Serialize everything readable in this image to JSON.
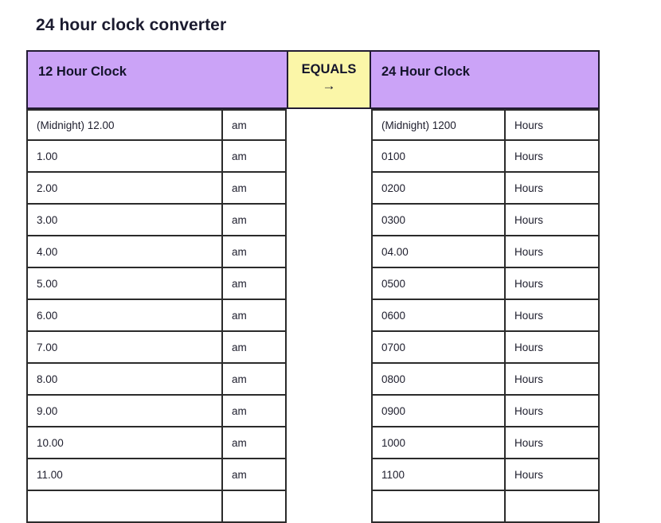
{
  "page": {
    "title": "24 hour clock converter",
    "background": "#ffffff"
  },
  "colors": {
    "header_purple": "#cba3f7",
    "header_yellow": "#fbf6a8",
    "border": "#2b2b2b",
    "text": "#20202f"
  },
  "table": {
    "headers": {
      "left": "12 Hour Clock",
      "middle": "EQUALS",
      "middle_icon": "→",
      "right": "24 Hour Clock"
    },
    "rows": [
      {
        "twelve": "(Midnight) 12.00",
        "meridiem": "am",
        "twentyfour": "(Midnight) 1200",
        "unit": "Hours"
      },
      {
        "twelve": "1.00",
        "meridiem": "am",
        "twentyfour": "0100",
        "unit": "Hours"
      },
      {
        "twelve": "2.00",
        "meridiem": "am",
        "twentyfour": "0200",
        "unit": "Hours"
      },
      {
        "twelve": "3.00",
        "meridiem": "am",
        "twentyfour": "0300",
        "unit": "Hours"
      },
      {
        "twelve": "4.00",
        "meridiem": "am",
        "twentyfour": "04.00",
        "unit": "Hours"
      },
      {
        "twelve": "5.00",
        "meridiem": "am",
        "twentyfour": "0500",
        "unit": "Hours"
      },
      {
        "twelve": "6.00",
        "meridiem": "am",
        "twentyfour": "0600",
        "unit": "Hours"
      },
      {
        "twelve": "7.00",
        "meridiem": "am",
        "twentyfour": "0700",
        "unit": "Hours"
      },
      {
        "twelve": "8.00",
        "meridiem": "am",
        "twentyfour": "0800",
        "unit": "Hours"
      },
      {
        "twelve": "9.00",
        "meridiem": "am",
        "twentyfour": "0900",
        "unit": "Hours"
      },
      {
        "twelve": "10.00",
        "meridiem": "am",
        "twentyfour": "1000",
        "unit": "Hours"
      },
      {
        "twelve": "11.00",
        "meridiem": "am",
        "twentyfour": "1100",
        "unit": "Hours"
      },
      {
        "twelve": "",
        "meridiem": "",
        "twentyfour": "",
        "unit": ""
      }
    ]
  }
}
